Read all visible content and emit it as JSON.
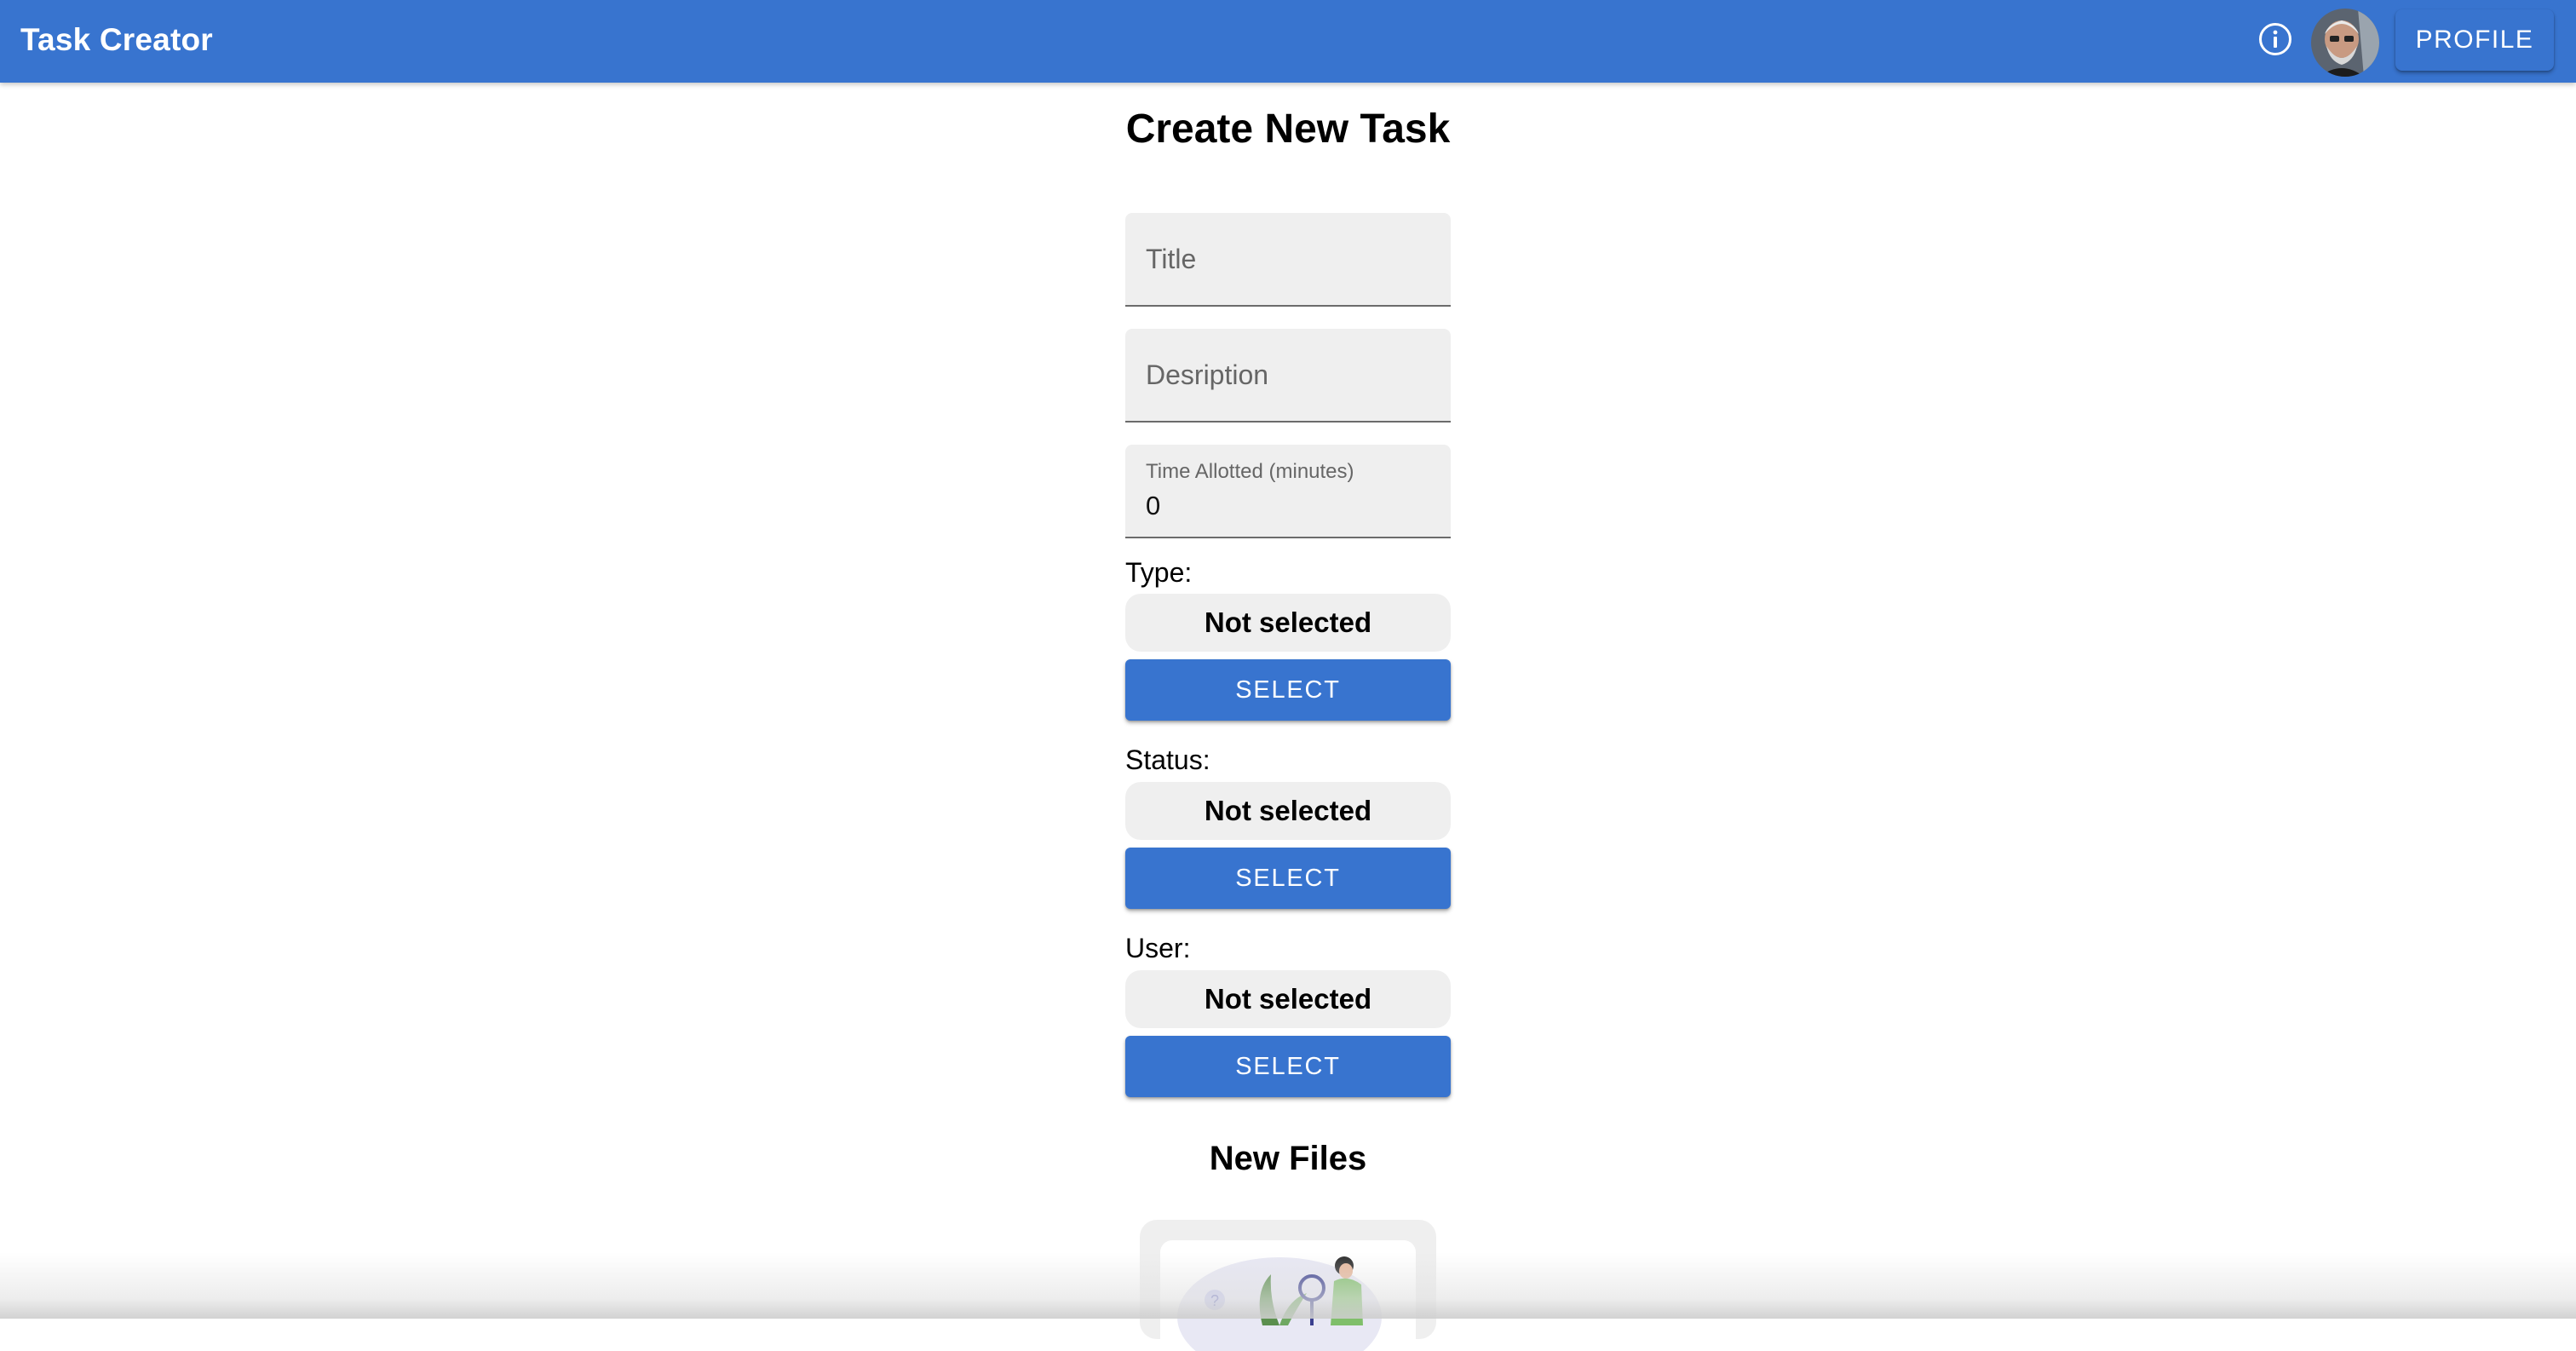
{
  "app": {
    "title": "Task Creator",
    "profile_label": "PROFILE",
    "accent_color": "#3874CF"
  },
  "icons": {
    "info": "info-icon",
    "avatar": "user-avatar"
  },
  "form": {
    "heading": "Create New Task",
    "title_field": {
      "placeholder": "Title",
      "value": ""
    },
    "description_field": {
      "placeholder": "Desription",
      "value": ""
    },
    "time_field": {
      "label": "Time Allotted (minutes)",
      "value": "0"
    },
    "type": {
      "label": "Type:",
      "value": "Not selected",
      "button": "SELECT"
    },
    "status": {
      "label": "Status:",
      "value": "Not selected",
      "button": "SELECT"
    },
    "user": {
      "label": "User:",
      "value": "Not selected",
      "button": "SELECT"
    }
  },
  "files": {
    "heading": "New Files",
    "illustration": "file-search-illustration"
  }
}
